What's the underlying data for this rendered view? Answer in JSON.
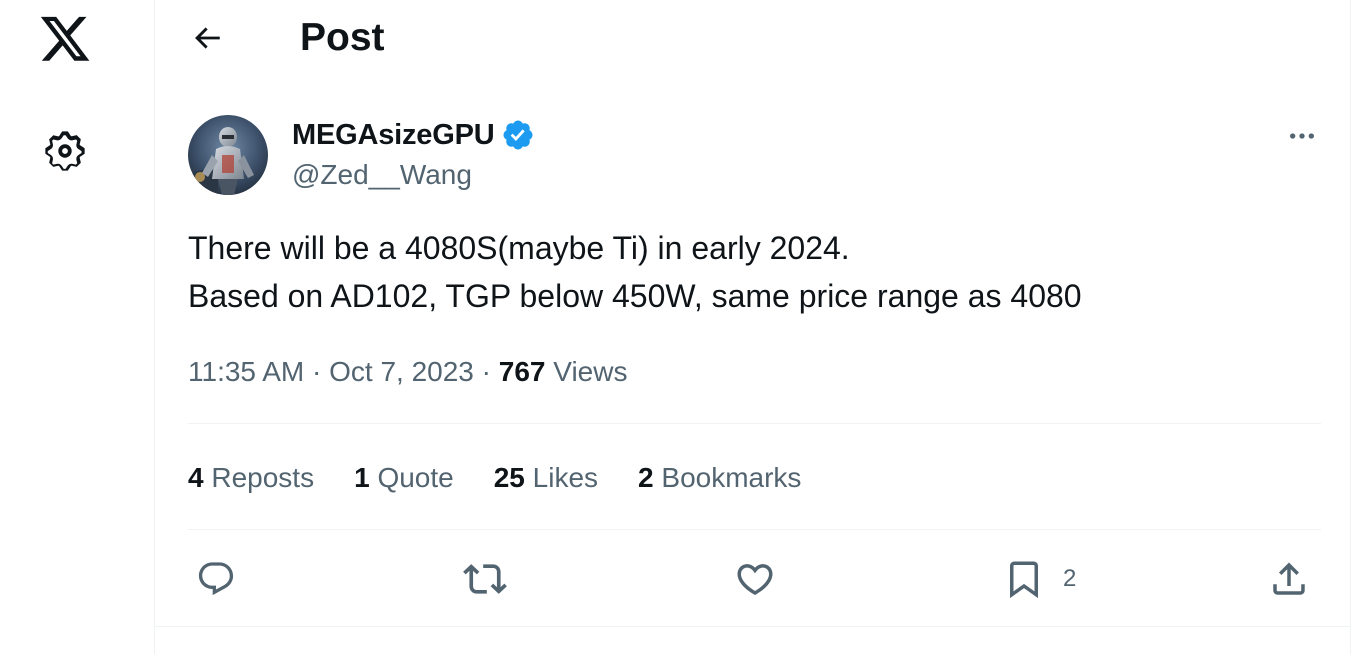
{
  "header": {
    "title": "Post"
  },
  "author": {
    "display_name": "MEGAsizeGPU",
    "handle": "@Zed__Wang",
    "verified": true
  },
  "post": {
    "lines": [
      "There will be a 4080S(maybe Ti) in early 2024.",
      "Based on AD102, TGP below 450W, same price range as 4080"
    ],
    "time": "11:35 AM",
    "separator": "·",
    "date": "Oct 7, 2023",
    "views_count": "767",
    "views_label": "Views"
  },
  "stats": [
    {
      "count": "4",
      "label": "Reposts"
    },
    {
      "count": "1",
      "label": "Quote"
    },
    {
      "count": "25",
      "label": "Likes"
    },
    {
      "count": "2",
      "label": "Bookmarks"
    }
  ],
  "actions": {
    "reply_icon": "reply-icon",
    "repost_icon": "repost-icon",
    "like_icon": "heart-icon",
    "bookmark_icon": "bookmark-icon",
    "bookmark_count": "2",
    "share_icon": "share-icon"
  },
  "colors": {
    "text_primary": "#0f1419",
    "text_secondary": "#536471",
    "verified_blue": "#1d9bf0",
    "divider": "#eff3f4"
  }
}
